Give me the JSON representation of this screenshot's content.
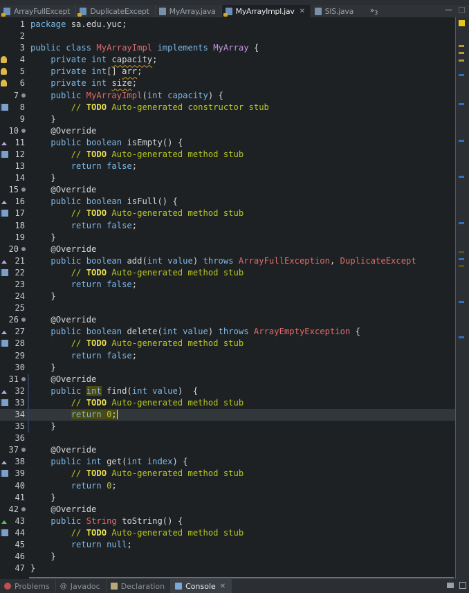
{
  "editor_tabs": [
    {
      "label": "ArrayFullExcept",
      "icon": "java-file-warning-icon",
      "active": false
    },
    {
      "label": "DuplicateExcept",
      "icon": "java-file-warning-icon",
      "active": false
    },
    {
      "label": "MyArray.java",
      "icon": "java-file-icon",
      "active": false
    },
    {
      "label": "MyArrayImpl.jav",
      "icon": "java-file-warning-icon",
      "active": true,
      "close": "✕"
    },
    {
      "label": "SIS.java",
      "icon": "java-file-icon",
      "active": false
    }
  ],
  "overflow": {
    "label": "»",
    "count": "3"
  },
  "code_lines": [
    {
      "n": "1",
      "text": "package sa.edu.yuc;"
    },
    {
      "n": "2",
      "text": ""
    },
    {
      "n": "3",
      "text": "public class MyArrayImpl implements MyArray {"
    },
    {
      "n": "4",
      "text": "    private int capacity;"
    },
    {
      "n": "5",
      "text": "    private int[] arr;"
    },
    {
      "n": "6",
      "text": "    private int size;"
    },
    {
      "n": "7",
      "text": "    public MyArrayImpl(int capacity) {"
    },
    {
      "n": "8",
      "text": "        // TODO Auto-generated constructor stub"
    },
    {
      "n": "9",
      "text": "    }"
    },
    {
      "n": "10",
      "text": "    @Override"
    },
    {
      "n": "11",
      "text": "    public boolean isEmpty() {"
    },
    {
      "n": "12",
      "text": "        // TODO Auto-generated method stub"
    },
    {
      "n": "13",
      "text": "        return false;"
    },
    {
      "n": "14",
      "text": "    }"
    },
    {
      "n": "15",
      "text": "    @Override"
    },
    {
      "n": "16",
      "text": "    public boolean isFull() {"
    },
    {
      "n": "17",
      "text": "        // TODO Auto-generated method stub"
    },
    {
      "n": "18",
      "text": "        return false;"
    },
    {
      "n": "19",
      "text": "    }"
    },
    {
      "n": "20",
      "text": "    @Override"
    },
    {
      "n": "21",
      "text": "    public boolean add(int value) throws ArrayFullException, DuplicateExcept"
    },
    {
      "n": "22",
      "text": "        // TODO Auto-generated method stub"
    },
    {
      "n": "23",
      "text": "        return false;"
    },
    {
      "n": "24",
      "text": "    }"
    },
    {
      "n": "25",
      "text": ""
    },
    {
      "n": "26",
      "text": "    @Override"
    },
    {
      "n": "27",
      "text": "    public boolean delete(int value) throws ArrayEmptyException {"
    },
    {
      "n": "28",
      "text": "        // TODO Auto-generated method stub"
    },
    {
      "n": "29",
      "text": "        return false;"
    },
    {
      "n": "30",
      "text": "    }"
    },
    {
      "n": "31",
      "text": "    @Override"
    },
    {
      "n": "32",
      "text": "    public int find(int value)  {"
    },
    {
      "n": "33",
      "text": "        // TODO Auto-generated method stub"
    },
    {
      "n": "34",
      "text": "        return 0;"
    },
    {
      "n": "35",
      "text": "    }"
    },
    {
      "n": "36",
      "text": ""
    },
    {
      "n": "37",
      "text": "    @Override"
    },
    {
      "n": "38",
      "text": "    public int get(int index) {"
    },
    {
      "n": "39",
      "text": "        // TODO Auto-generated method stub"
    },
    {
      "n": "40",
      "text": "        return 0;"
    },
    {
      "n": "41",
      "text": "    }"
    },
    {
      "n": "42",
      "text": "    @Override"
    },
    {
      "n": "43",
      "text": "    public String toString() {"
    },
    {
      "n": "44",
      "text": "        // TODO Auto-generated method stub"
    },
    {
      "n": "45",
      "text": "        return null;"
    },
    {
      "n": "46",
      "text": "    }"
    },
    {
      "n": "47",
      "text": "}"
    }
  ],
  "current_line": "34",
  "bottom_tabs": [
    {
      "label": "Problems",
      "icon": "problems-icon",
      "active": false
    },
    {
      "label": "Javadoc",
      "icon": "javadoc-icon",
      "active": false
    },
    {
      "label": "Declaration",
      "icon": "declaration-icon",
      "active": false
    },
    {
      "label": "Console",
      "icon": "console-icon",
      "active": true,
      "close": "✕"
    }
  ],
  "colors": {
    "editor_bg": "#1e2124",
    "keyword": "#7cb8e6",
    "type": "#e06a6a",
    "interface": "#c495e0",
    "comment": "#b6c61e",
    "todo": "#e8e052",
    "number": "#b8c04a"
  }
}
